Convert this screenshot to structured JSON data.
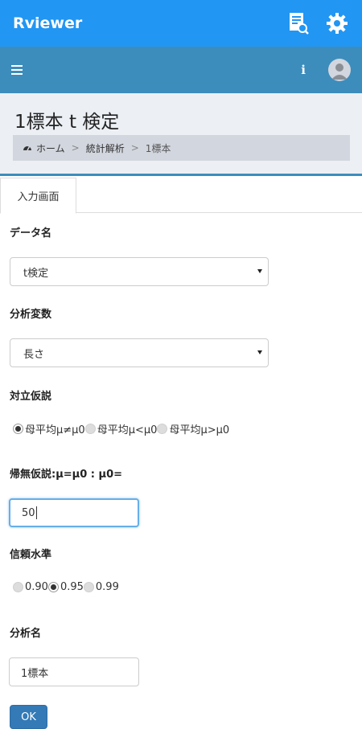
{
  "app": {
    "title": "Rviewer"
  },
  "page": {
    "title": "1標本 t 検定"
  },
  "breadcrumb": {
    "home": "ホーム",
    "sep": ">",
    "level2": "統計解析",
    "current": "1標本"
  },
  "tabs": [
    {
      "label": "入力画面"
    }
  ],
  "form": {
    "dataset": {
      "label": "データ名",
      "value": "t検定"
    },
    "variable": {
      "label": "分析変数",
      "value": "長さ"
    },
    "alternative": {
      "label": "対立仮説",
      "options": [
        {
          "label": "母平均μ≠μ0",
          "selected": true
        },
        {
          "label": "母平均μ<μ0",
          "selected": false
        },
        {
          "label": "母平均μ>μ0",
          "selected": false
        }
      ]
    },
    "null": {
      "label": "帰無仮説:μ=μ0 : μ0=",
      "value": "50"
    },
    "confidence": {
      "label": "信頼水準",
      "options": [
        {
          "label": "0.90",
          "selected": false
        },
        {
          "label": "0.95",
          "selected": true
        },
        {
          "label": "0.99",
          "selected": false
        }
      ]
    },
    "analysis_name": {
      "label": "分析名",
      "value": "1標本"
    },
    "ok_label": "OK"
  },
  "icons": {
    "report": "report-search-icon",
    "settings": "gear-icon",
    "menu": "hamburger-icon",
    "info": "info-icon",
    "user": "avatar"
  },
  "colors": {
    "appbar": "#2196f3",
    "navbar": "#3c8dbc",
    "header_bg": "#ecf0f5",
    "ok_button": "#337ab7"
  }
}
